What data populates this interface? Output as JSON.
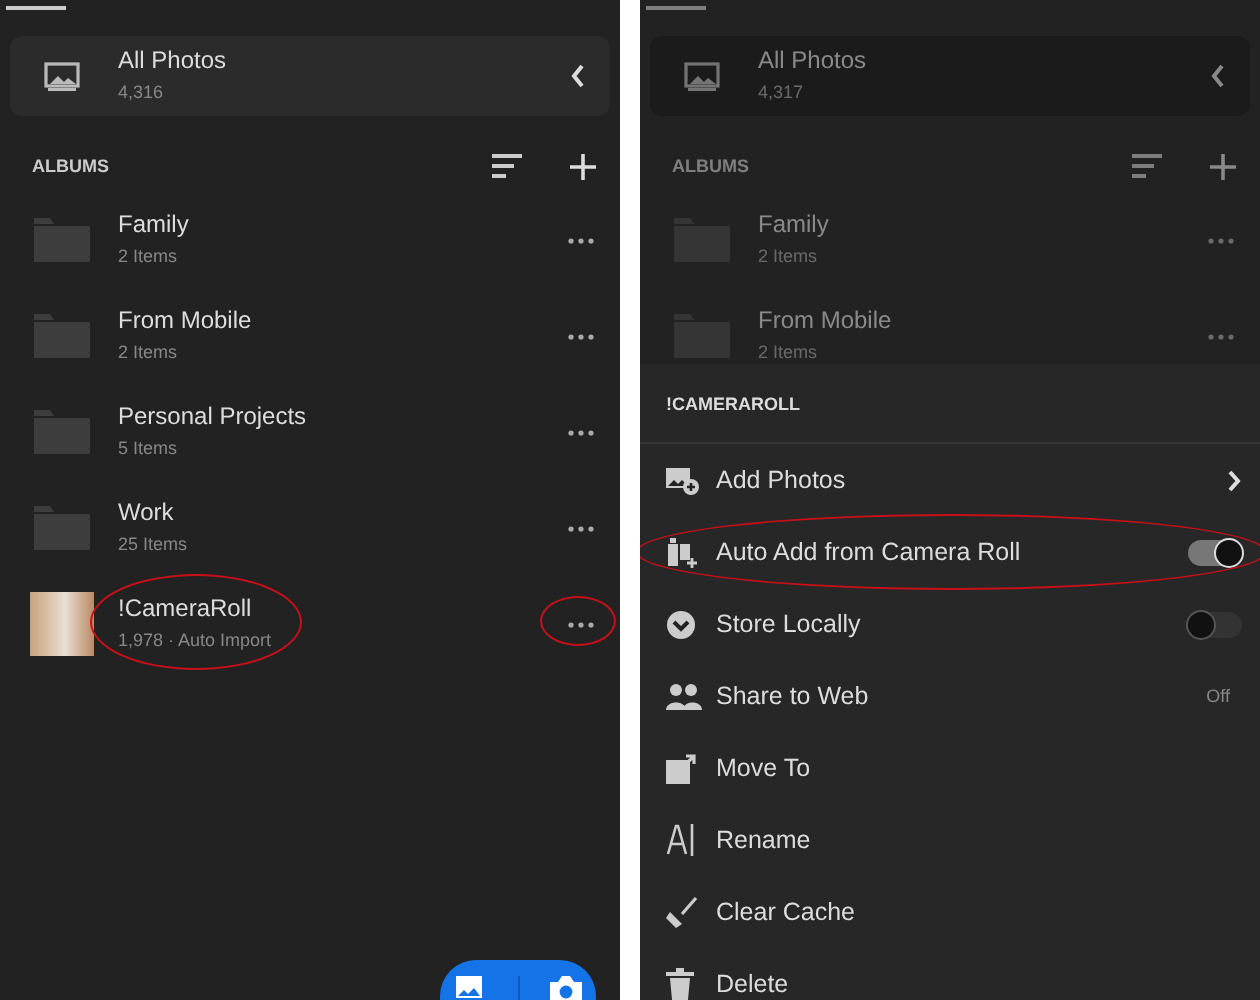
{
  "panels": [
    {
      "dimmed": false,
      "all_photos": {
        "title": "All Photos",
        "count": "4,316"
      },
      "albums_header": "ALBUMS",
      "albums": [
        {
          "kind": "folder",
          "name": "Family",
          "meta": "2 Items",
          "highlighted": false,
          "more_highlighted": false
        },
        {
          "kind": "folder",
          "name": "From Mobile",
          "meta": "2 Items",
          "highlighted": false,
          "more_highlighted": false
        },
        {
          "kind": "folder",
          "name": "Personal Projects",
          "meta": "5 Items",
          "highlighted": false,
          "more_highlighted": false
        },
        {
          "kind": "folder",
          "name": "Work",
          "meta": "25 Items",
          "highlighted": false,
          "more_highlighted": false
        },
        {
          "kind": "photo",
          "name": "!CameraRoll",
          "meta": "1,978 · Auto Import",
          "highlighted": true,
          "more_highlighted": true
        }
      ]
    },
    {
      "dimmed": true,
      "all_photos": {
        "title": "All Photos",
        "count": "4,317"
      },
      "albums_header": "ALBUMS",
      "albums": [
        {
          "kind": "folder",
          "name": "Family",
          "meta": "2 Items",
          "highlighted": false,
          "more_highlighted": false
        },
        {
          "kind": "folder",
          "name": "From Mobile",
          "meta": "2 Items",
          "highlighted": false,
          "more_highlighted": false
        }
      ],
      "sheet": {
        "title": "!CAMERAROLL",
        "items": [
          {
            "kind": "nav",
            "label": "Add Photos",
            "highlighted": false
          },
          {
            "kind": "toggle",
            "label": "Auto Add from Camera Roll",
            "on": true,
            "highlighted": true
          },
          {
            "kind": "toggle",
            "label": "Store Locally",
            "on": false,
            "highlighted": false
          },
          {
            "kind": "value",
            "label": "Share to Web",
            "value": "Off",
            "highlighted": false
          },
          {
            "kind": "plain",
            "label": "Move To",
            "highlighted": false
          },
          {
            "kind": "plain",
            "label": "Rename",
            "highlighted": false
          },
          {
            "kind": "plain",
            "label": "Clear Cache",
            "highlighted": false
          },
          {
            "kind": "plain",
            "label": "Delete",
            "highlighted": false
          }
        ]
      }
    }
  ]
}
